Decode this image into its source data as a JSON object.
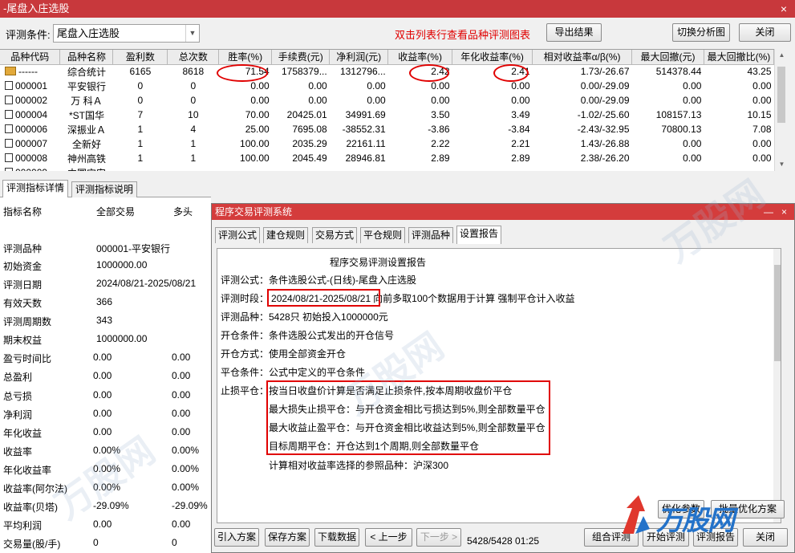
{
  "window": {
    "title": "-尾盘入庄选股",
    "close_glyph": "×"
  },
  "toolbar": {
    "condition_label": "评测条件:",
    "condition_value": "尾盘入庄选股",
    "hint": "双击列表行查看品种评测图表",
    "export_label": "导出结果",
    "switch_label": "切换分析图",
    "close_label": "关闭"
  },
  "grid": {
    "headers": [
      "品种代码",
      "品种名称",
      "盈利数",
      "总次数",
      "胜率(%)",
      "手续费(元)",
      "净利润(元)",
      "收益率(%)",
      "年化收益率(%)",
      "相对收益率α/β(%)",
      "最大回撤(元)",
      "最大回撤比(%)"
    ],
    "rows": [
      [
        "------",
        "综合统计",
        "6165",
        "8618",
        "71.54",
        "1758379...",
        "1312796...",
        "2.42",
        "2.41",
        "1.73/-26.67",
        "514378.44",
        "43.25"
      ],
      [
        "000001",
        "平安银行",
        "0",
        "0",
        "0.00",
        "0.00",
        "0.00",
        "0.00",
        "0.00",
        "0.00/-29.09",
        "0.00",
        "0.00"
      ],
      [
        "000002",
        "万 科Ａ",
        "0",
        "0",
        "0.00",
        "0.00",
        "0.00",
        "0.00",
        "0.00",
        "0.00/-29.09",
        "0.00",
        "0.00"
      ],
      [
        "000004",
        "*ST国华",
        "7",
        "10",
        "70.00",
        "20425.01",
        "34991.69",
        "3.50",
        "3.49",
        "-1.02/-25.60",
        "108157.13",
        "10.15"
      ],
      [
        "000006",
        "深振业Ａ",
        "1",
        "4",
        "25.00",
        "7695.08",
        "-38552.31",
        "-3.86",
        "-3.84",
        "-2.43/-32.95",
        "70800.13",
        "7.08"
      ],
      [
        "000007",
        "全新好",
        "1",
        "1",
        "100.00",
        "2035.29",
        "22161.11",
        "2.22",
        "2.21",
        "1.43/-26.88",
        "0.00",
        "0.00"
      ],
      [
        "000008",
        "神州高铁",
        "1",
        "1",
        "100.00",
        "2045.49",
        "28946.81",
        "2.89",
        "2.89",
        "2.38/-26.20",
        "0.00",
        "0.00"
      ],
      [
        "000009",
        "中国宝安",
        "",
        "",
        "",
        "",
        "",
        "",
        "",
        "",
        "",
        ""
      ]
    ]
  },
  "left_panel": {
    "tabs": [
      "评测指标详情",
      "评测指标说明"
    ],
    "header": [
      "指标名称",
      "全部交易",
      "多头"
    ],
    "rows": [
      [
        "评测品种",
        "000001-平安银行",
        ""
      ],
      [
        "初始资金",
        "1000000.00",
        ""
      ],
      [
        "评测日期",
        "2024/08/21-2025/08/21",
        ""
      ],
      [
        "有效天数",
        "366",
        ""
      ],
      [
        "评测周期数",
        "343",
        ""
      ],
      [
        "期末权益",
        "1000000.00",
        ""
      ],
      [
        "盈亏时间比",
        "0.00",
        "0.00"
      ],
      [
        "总盈利",
        "0.00",
        "0.00"
      ],
      [
        "总亏损",
        "0.00",
        "0.00"
      ],
      [
        "净利润",
        "0.00",
        "0.00"
      ],
      [
        "年化收益",
        "0.00",
        "0.00"
      ],
      [
        "收益率",
        "0.00%",
        "0.00%"
      ],
      [
        "年化收益率",
        "0.00%",
        "0.00%"
      ],
      [
        "收益率(阿尔法)",
        "0.00%",
        "0.00%"
      ],
      [
        "收益率(贝塔)",
        "-29.09%",
        "-29.09%"
      ],
      [
        "平均利润",
        "0.00",
        "0.00"
      ],
      [
        "交易量(股/手)",
        "0",
        "0"
      ]
    ]
  },
  "dialog": {
    "title": "程序交易评测系统",
    "min_glyph": "—",
    "close_glyph": "×",
    "tabs": [
      "评测公式",
      "建仓规则",
      "交易方式",
      "平仓规则",
      "评测品种",
      "设置报告"
    ],
    "report": {
      "heading": "程序交易评测设置报告",
      "formula": "评测公式：条件选股公式-(日线)-尾盘入庄选股",
      "period_label": "评测时段：",
      "period_value": "2024/08/21-2025/08/21",
      "period_rest": "向前多取100个数据用于计算 强制平仓计入收益",
      "varieties": "评测品种：5428只 初始投入1000000元",
      "open_cond": "开仓条件：条件选股公式发出的开仓信号",
      "open_mode": "开仓方式：使用全部资金开仓",
      "close_cond": "平仓条件：公式中定义的平仓条件",
      "stop_label": "止损平仓：",
      "stop_lines": [
        "按当日收盘价计算是否满足止损条件,按本周期收盘价平仓",
        "最大损失止损平仓：与开仓资金相比亏损达到5%,则全部数量平仓",
        "最大收益止盈平仓：与开仓资金相比收益达到5%,则全部数量平仓",
        "目标周期平仓：开仓达到1个周期,则全部数量平仓"
      ],
      "benchmark": "计算相对收益率选择的参照品种：沪深300"
    },
    "buttons": {
      "import": "引入方案",
      "save": "保存方案",
      "download": "下载数据",
      "prev": "< 上一步",
      "next": "下一步 >",
      "optimize": "优化参数",
      "plan": "批量优化方案",
      "combo": "组合评测",
      "start": "开始评测",
      "report": "评测报告",
      "close": "关闭"
    },
    "status": "5428/5428  01:25"
  },
  "watermark": {
    "text": "万股网",
    "logo_text": "万股网"
  },
  "colors": {
    "title_red": "#c8383c",
    "hint_red": "#e00000",
    "logo_blue": "#2372c9"
  }
}
